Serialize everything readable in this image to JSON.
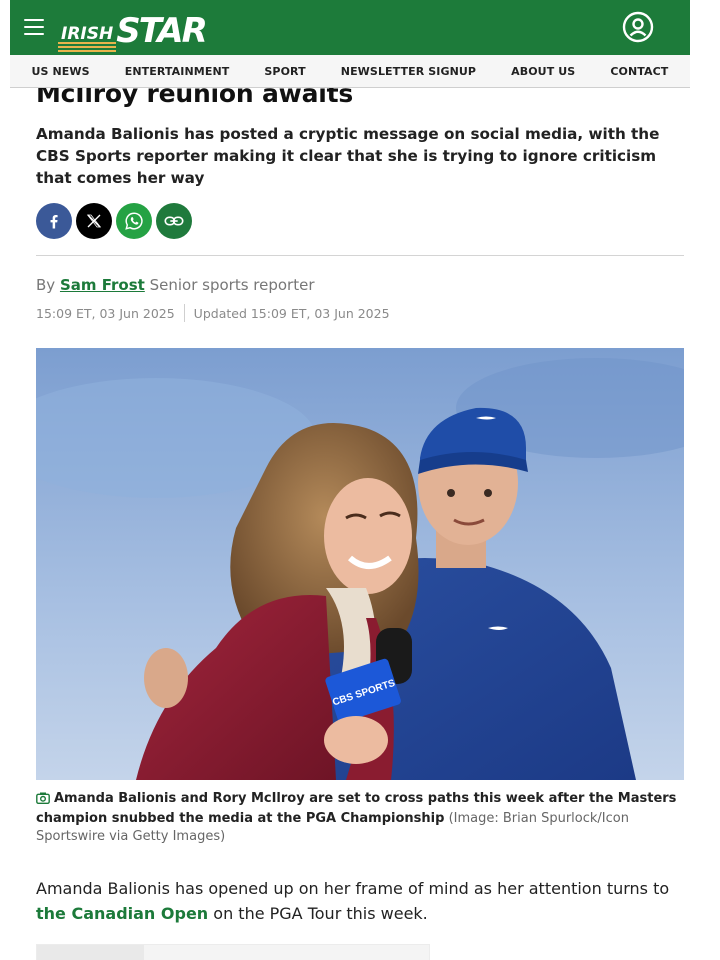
{
  "header": {
    "logo_text_irish": "IRISH",
    "logo_text_star": "STAR"
  },
  "nav": {
    "items": [
      {
        "label": "US NEWS"
      },
      {
        "label": "ENTERTAINMENT"
      },
      {
        "label": "SPORT"
      },
      {
        "label": "NEWSLETTER SIGNUP"
      },
      {
        "label": "ABOUT US"
      },
      {
        "label": "CONTACT"
      }
    ]
  },
  "article": {
    "headline_visible": "McIlroy reunion awaits",
    "standfirst": "Amanda Balionis has posted a cryptic message on social media, with the CBS Sports reporter making it clear that she is trying to ignore criticism that comes her way",
    "share": [
      {
        "icon": "facebook-icon"
      },
      {
        "icon": "x-icon"
      },
      {
        "icon": "whatsapp-icon"
      },
      {
        "icon": "link-icon"
      }
    ],
    "byline": {
      "prefix": "By",
      "author": "Sam Frost",
      "role": "Senior sports reporter"
    },
    "dates": {
      "published": "15:09 ET, 03 Jun 2025",
      "updated": "Updated 15:09 ET, 03 Jun 2025"
    },
    "image_caption": {
      "main": "Amanda Balionis and Rory McIlroy are set to cross paths this week after the Masters champion snubbed the media at the PGA Championship",
      "credit": "(Image: Brian Spurlock/Icon Sportswire via Getty Images)"
    },
    "body": {
      "p1_before": "Amanda Balionis has opened up on her frame of mind as her attention turns to ",
      "p1_link": "the Canadian Open",
      "p1_after": " on the PGA Tour this week."
    },
    "photo_labels": {
      "mic_flag": "CBS SPORTS"
    }
  },
  "colors": {
    "brand_green": "#1d7b3a",
    "link_green": "#1c7a3a",
    "facebook": "#3b5998",
    "whatsapp": "#25a244"
  }
}
